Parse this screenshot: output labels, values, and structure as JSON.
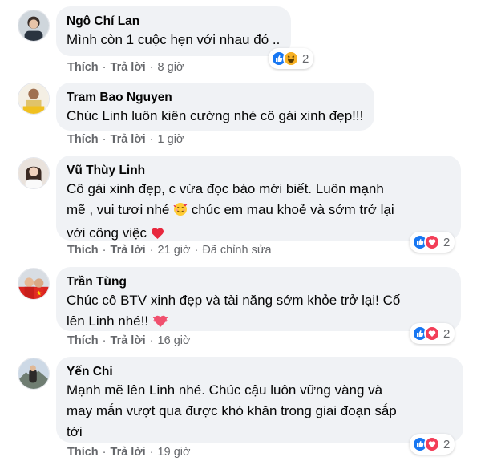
{
  "comments": [
    {
      "author": "Ngô Chí Lan",
      "text": "Mình còn 1 cuộc hẹn với nhau đó ..",
      "like_label": "Thích",
      "reply_label": "Trả lời",
      "time": "8 giờ",
      "reactions": [
        "like-icon",
        "haha-icon"
      ],
      "reaction_count": "2"
    },
    {
      "author": "Tram Bao Nguyen",
      "text": "Chúc Linh luôn kiên cường nhé cô gái xinh đẹp!!!",
      "like_label": "Thích",
      "reply_label": "Trả lời",
      "time": "1 giờ"
    },
    {
      "author": "Vũ Thùy Linh",
      "text_line1": "Cô gái xinh đẹp, c vừa đọc báo mới biết. Luôn mạnh",
      "text_line2_a": "mẽ , vui tươi nhé",
      "text_line2_b": "chúc em mau khoẻ và sớm trở lại",
      "text_line3": "với công việc",
      "like_label": "Thích",
      "reply_label": "Trả lời",
      "time": "21 giờ",
      "edited_label": "Đã chỉnh sửa",
      "reactions": [
        "like-icon",
        "love-icon"
      ],
      "reaction_count": "2"
    },
    {
      "author": "Trần Tùng",
      "text_line1": "Chúc cô BTV xinh đẹp và tài năng sớm khỏe trở lại! Cố",
      "text_line2": "lên Linh nhé!!",
      "like_label": "Thích",
      "reply_label": "Trả lời",
      "time": "16 giờ",
      "reactions": [
        "like-icon",
        "love-icon"
      ],
      "reaction_count": "2"
    },
    {
      "author": "Yến Chi",
      "text": "Mạnh mẽ lên Linh nhé. Chúc cậu luôn vững vàng và\nmay mắn vượt qua được khó khăn trong giai đoạn sắp\ntới",
      "like_label": "Thích",
      "reply_label": "Trả lời",
      "time": "19 giờ",
      "reactions": [
        "like-icon",
        "love-icon"
      ],
      "reaction_count": "2"
    }
  ],
  "colors": {
    "bubble": "#f0f2f5",
    "meta_text": "#65676b",
    "like_blue": "#1877f2",
    "love_red": "#f33e58",
    "haha_yellow": "#f7b125"
  }
}
